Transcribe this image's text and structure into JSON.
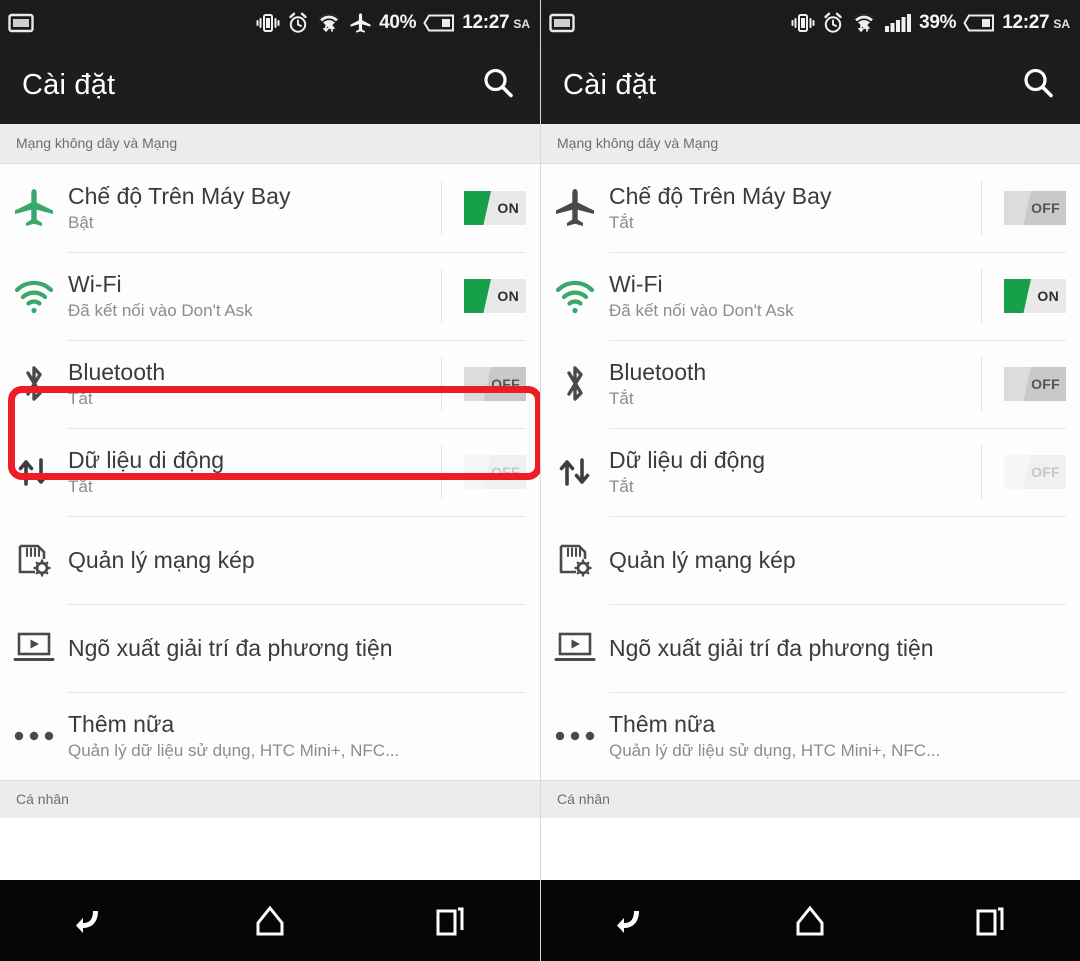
{
  "panels": [
    {
      "id": "left",
      "statusbar": {
        "left_icon": "notification-screenshot-icon",
        "icons": [
          "vibrate-icon",
          "alarm-clock-icon",
          "wifi-transfer-icon",
          "airplane-icon"
        ],
        "battery_percent": "40%",
        "time": "12:27",
        "ampm": "SA"
      },
      "actionbar": {
        "title": "Cài đặt",
        "search_icon": "search-icon"
      },
      "section_header": "Mạng không dây và Mạng",
      "bottom_section_header": "Cá nhân",
      "rows": [
        {
          "icon": "airplane-icon",
          "icon_state": "active",
          "title": "Chế độ Trên Máy Bay",
          "subtitle": "Bật",
          "toggle": "ON",
          "toggle_state": "on"
        },
        {
          "icon": "wifi-icon",
          "icon_state": "active",
          "title": "Wi-Fi",
          "subtitle": "Đã kết nối vào Don't Ask",
          "toggle": "ON",
          "toggle_state": "on"
        },
        {
          "icon": "bluetooth-icon",
          "icon_state": "inactive",
          "title": "Bluetooth",
          "subtitle": "Tắt",
          "toggle": "OFF",
          "toggle_state": "off"
        },
        {
          "icon": "mobile-data-icon",
          "icon_state": "inactive",
          "title": "Dữ liệu di động",
          "subtitle": "Tắt",
          "toggle": "OFF",
          "toggle_state": "disabled"
        },
        {
          "icon": "dual-sim-manager-icon",
          "icon_state": "inactive",
          "title": "Quản lý mạng kép",
          "subtitle": "",
          "toggle": "",
          "toggle_state": "none"
        },
        {
          "icon": "media-output-icon",
          "icon_state": "inactive",
          "title": "Ngõ xuất giải trí đa phương tiện",
          "subtitle": "",
          "toggle": "",
          "toggle_state": "none"
        },
        {
          "icon": "more-dots-icon",
          "icon_state": "inactive",
          "title": "Thêm nữa",
          "subtitle": "Quản lý dữ liệu sử dụng, HTC Mini+, NFC...",
          "toggle": "",
          "toggle_state": "none"
        }
      ],
      "navbar": {
        "back": "back-icon",
        "home": "home-icon",
        "recents": "recents-icon"
      },
      "highlight": {
        "target": "Wi-Fi",
        "color": "#ee1c25"
      }
    },
    {
      "id": "right",
      "statusbar": {
        "left_icon": "notification-screenshot-icon",
        "icons": [
          "vibrate-icon",
          "alarm-clock-icon",
          "wifi-transfer-icon",
          "signal-bars-icon"
        ],
        "battery_percent": "39%",
        "time": "12:27",
        "ampm": "SA"
      },
      "actionbar": {
        "title": "Cài đặt",
        "search_icon": "search-icon"
      },
      "section_header": "Mạng không dây và Mạng",
      "bottom_section_header": "Cá nhân",
      "rows": [
        {
          "icon": "airplane-icon",
          "icon_state": "inactive",
          "title": "Chế độ Trên Máy Bay",
          "subtitle": "Tắt",
          "toggle": "OFF",
          "toggle_state": "off"
        },
        {
          "icon": "wifi-icon",
          "icon_state": "active",
          "title": "Wi-Fi",
          "subtitle": "Đã kết nối vào Don't Ask",
          "toggle": "ON",
          "toggle_state": "on"
        },
        {
          "icon": "bluetooth-icon",
          "icon_state": "inactive",
          "title": "Bluetooth",
          "subtitle": "Tắt",
          "toggle": "OFF",
          "toggle_state": "off"
        },
        {
          "icon": "mobile-data-icon",
          "icon_state": "inactive",
          "title": "Dữ liệu di động",
          "subtitle": "Tắt",
          "toggle": "OFF",
          "toggle_state": "disabled"
        },
        {
          "icon": "dual-sim-manager-icon",
          "icon_state": "inactive",
          "title": "Quản lý mạng kép",
          "subtitle": "",
          "toggle": "",
          "toggle_state": "none"
        },
        {
          "icon": "media-output-icon",
          "icon_state": "inactive",
          "title": "Ngõ xuất giải trí đa phương tiện",
          "subtitle": "",
          "toggle": "",
          "toggle_state": "none"
        },
        {
          "icon": "more-dots-icon",
          "icon_state": "inactive",
          "title": "Thêm nữa",
          "subtitle": "Quản lý dữ liệu sử dụng, HTC Mini+, NFC...",
          "toggle": "",
          "toggle_state": "none"
        }
      ],
      "navbar": {
        "back": "back-icon",
        "home": "home-icon",
        "recents": "recents-icon"
      },
      "highlight": null
    }
  ],
  "colors": {
    "accent_green": "#17a04a",
    "highlight_red": "#ee1c25",
    "status_bar_bg": "#1b1b1b",
    "action_bar_bg": "#1d1d1d",
    "section_header_bg": "#ececec"
  }
}
